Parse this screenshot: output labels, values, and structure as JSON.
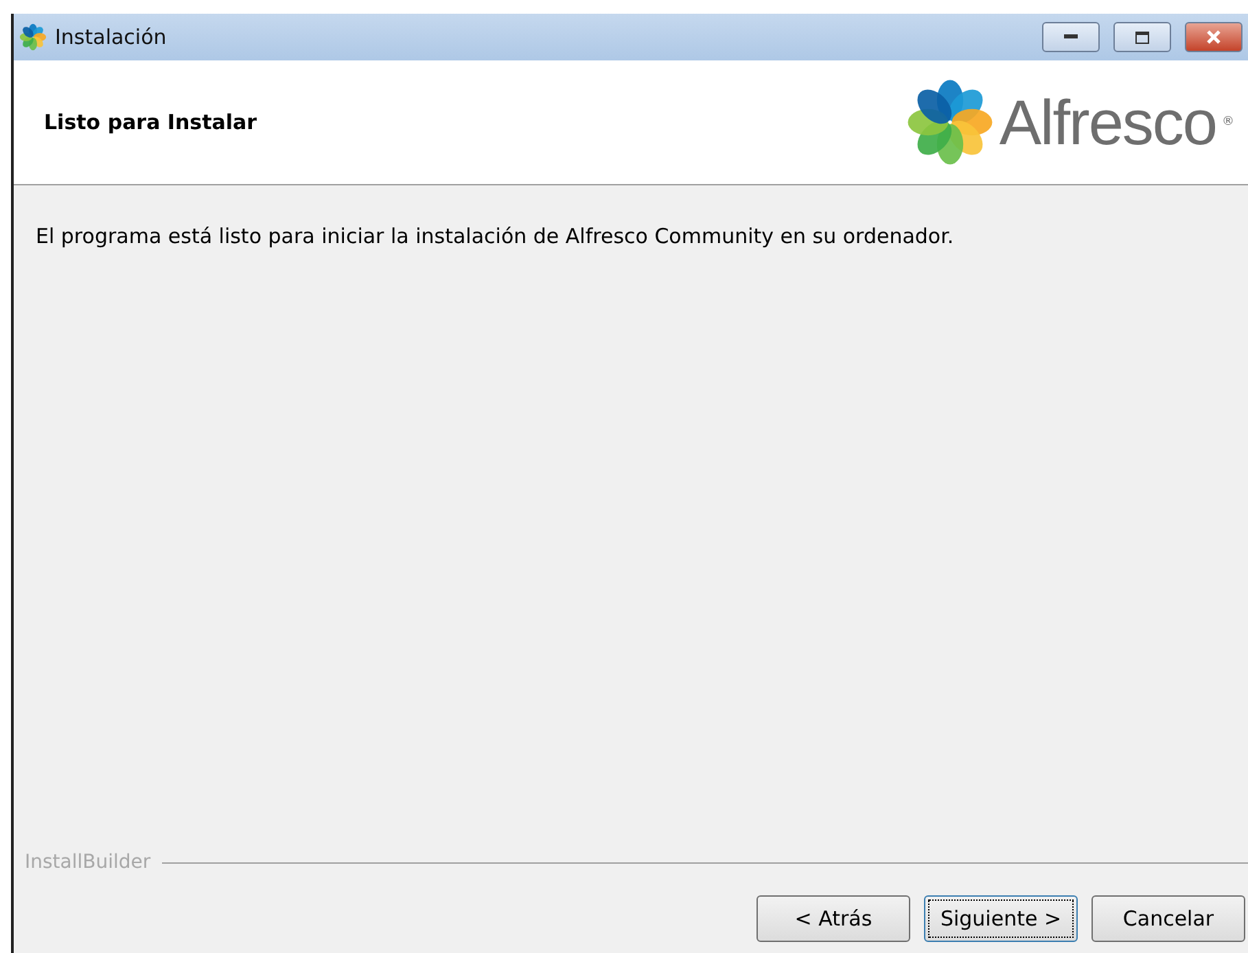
{
  "window": {
    "title": "Instalación"
  },
  "header": {
    "title": "Listo para Instalar",
    "logo_text": "Alfresco",
    "logo_mark": "®"
  },
  "body": {
    "message": "El programa está listo para iniciar la instalación de Alfresco Community en su ordenador."
  },
  "footer": {
    "brand": "InstallBuilder"
  },
  "buttons": [
    {
      "label": "< Atrás",
      "focused": false
    },
    {
      "label": "Siguiente >",
      "focused": true
    },
    {
      "label": "Cancelar",
      "focused": false
    }
  ]
}
